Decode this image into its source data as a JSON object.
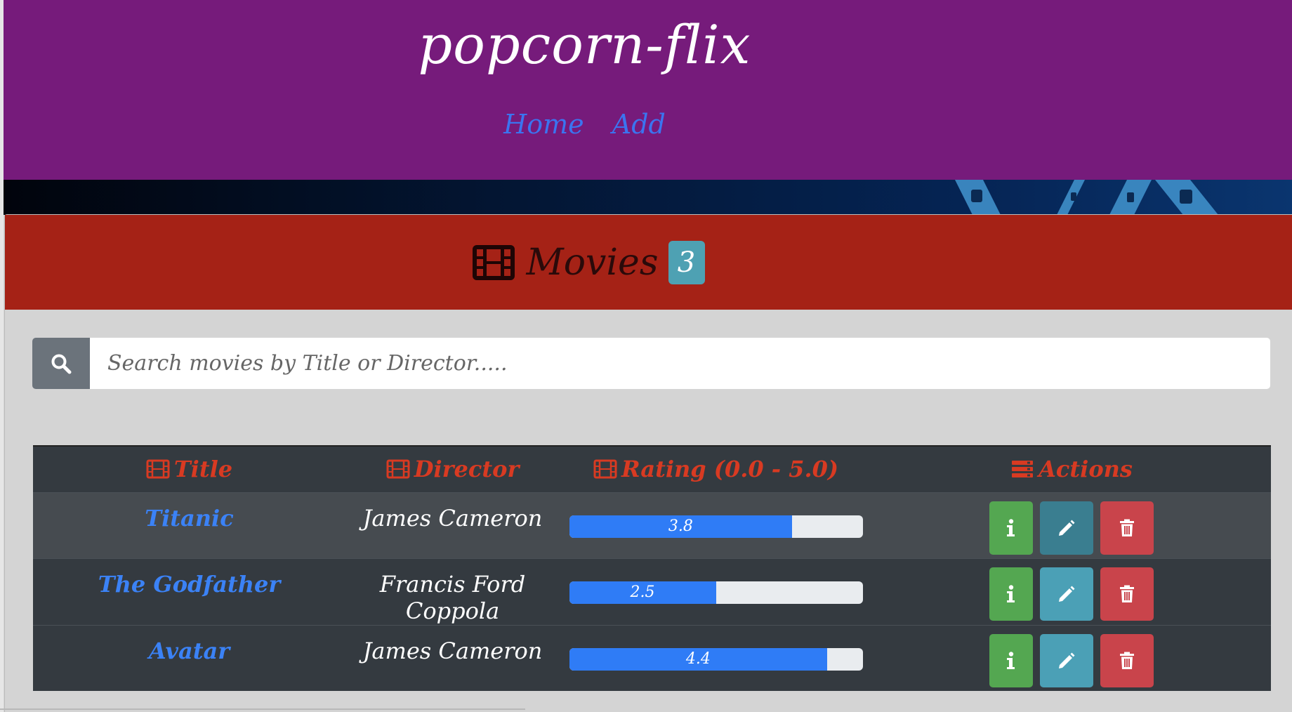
{
  "app": {
    "brand": "popcorn-flix",
    "nav": [
      {
        "label": "Home"
      },
      {
        "label": "Add"
      }
    ]
  },
  "panel": {
    "title": "Movies",
    "count": "3"
  },
  "search": {
    "placeholder": "Search movies by Title or Director.....",
    "value": ""
  },
  "table": {
    "headers": {
      "title": "Title",
      "director": "Director",
      "rating": "Rating (0.0 - 5.0)",
      "actions": "Actions"
    },
    "rating_max": 5.0,
    "rows": [
      {
        "title": "Titanic",
        "director": "James Cameron",
        "rating": "3.8",
        "rating_value": 3.8
      },
      {
        "title": "The Godfather",
        "director": "Francis Ford Coppola",
        "rating": "2.5",
        "rating_value": 2.5
      },
      {
        "title": "Avatar",
        "director": "James Cameron",
        "rating": "4.4",
        "rating_value": 4.4
      }
    ]
  },
  "colors": {
    "header_bg": "#761b7b",
    "panel_heading_bg": "#a52216",
    "badge_bg": "#4ea1b3",
    "link_blue": "#3b82f6",
    "table_bg": "#343a40",
    "header_text": "#d83a22",
    "progress_fill": "#2f7cf6",
    "info_btn": "#54a751",
    "edit_btn": "#4ba0b6",
    "delete_btn": "#c9444b"
  },
  "icons": {
    "heading": "film-icon",
    "search": "search-icon",
    "column_header": "film-icon",
    "actions_header": "server-icon",
    "info": "info-icon",
    "edit": "pencil-icon",
    "delete": "trash-icon"
  }
}
